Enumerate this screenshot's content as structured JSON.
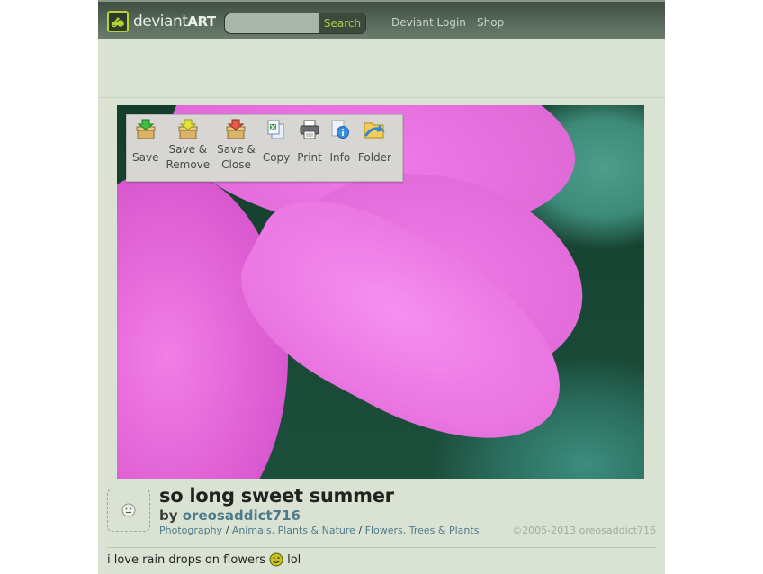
{
  "header": {
    "logo_text_light": "deviant",
    "logo_text_bold": "ART",
    "search": {
      "value": "",
      "placeholder": "",
      "button_label": "Search"
    },
    "nav": [
      {
        "label": "Deviant Login"
      },
      {
        "label": "Shop"
      }
    ]
  },
  "toolbar": {
    "buttons": [
      {
        "label_line1": "Save",
        "label_line2": "",
        "icon": "box-green-arrow-icon"
      },
      {
        "label_line1": "Save &",
        "label_line2": "Remove",
        "icon": "box-yellow-arrow-icon"
      },
      {
        "label_line1": "Save &",
        "label_line2": "Close",
        "icon": "box-red-arrow-icon"
      },
      {
        "label_line1": "Copy",
        "label_line2": "",
        "icon": "copy-icon"
      },
      {
        "label_line1": "Print",
        "label_line2": "",
        "icon": "printer-icon"
      },
      {
        "label_line1": "Info",
        "label_line2": "",
        "icon": "info-icon"
      },
      {
        "label_line1": "Folder",
        "label_line2": "",
        "icon": "folder-icon"
      }
    ]
  },
  "deviation": {
    "title": "so long sweet summer",
    "by_label": "by",
    "author": "oreosaddict716",
    "categories": [
      "Photography",
      "Animals, Plants & Nature",
      "Flowers, Trees & Plants"
    ],
    "category_separator": "/",
    "copyright": "©2005-2013 oreosaddict716",
    "description_before": "i love rain drops on flowers",
    "description_after": "lol"
  },
  "colors": {
    "topbar": "#4f6152",
    "page_bg": "#dae3d3",
    "accent_green": "#b7d332",
    "link": "#4e7a8a"
  }
}
